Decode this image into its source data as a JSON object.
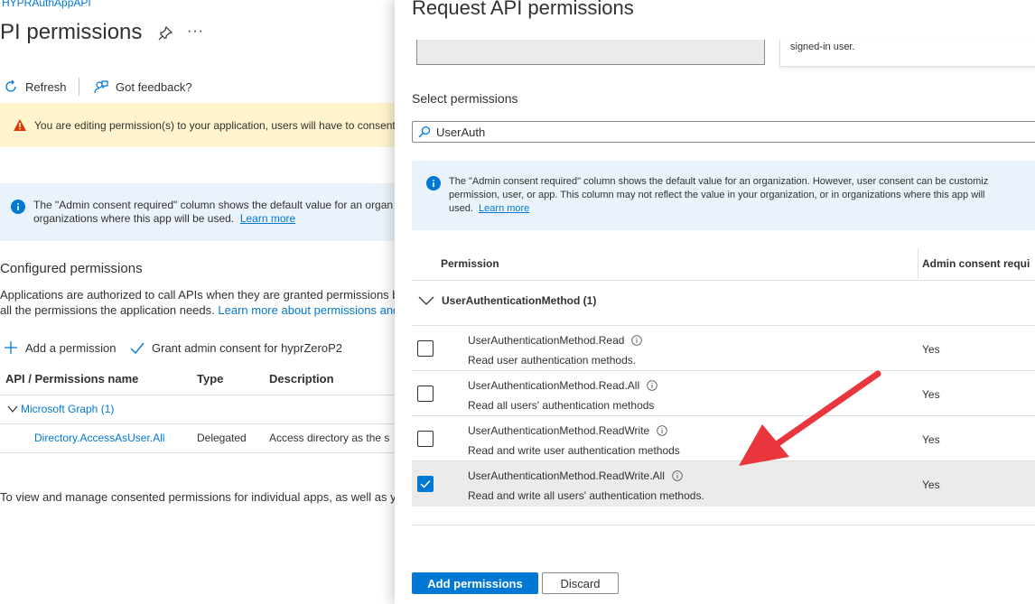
{
  "left": {
    "breadcrumb": "HYPRAuthAppAPI",
    "title": "PI permissions",
    "more": "···",
    "toolbar": {
      "refresh": "Refresh",
      "feedback": "Got feedback?"
    },
    "warning": "You are editing permission(s) to your application, users will have to consent",
    "info": {
      "line1": "The \"Admin consent required\" column shows the default value for an organ",
      "line2": "organizations where this app will be used.",
      "link": "Learn more"
    },
    "configured": {
      "title": "Configured permissions",
      "desc_line1": "Applications are authorized to call APIs when they are granted permissions by",
      "desc_line2": "all the permissions the application needs.",
      "desc_link": "Learn more about permissions and"
    },
    "actions": {
      "add": "Add a permission",
      "grant": "Grant admin consent for hyprZeroP2"
    },
    "table": {
      "headers": {
        "api": "API / Permissions name",
        "type": "Type",
        "description": "Description"
      },
      "group": "Microsoft Graph (1)",
      "rows": [
        {
          "name": "Directory.AccessAsUser.All",
          "type": "Delegated",
          "description": "Access directory as the s"
        }
      ]
    },
    "footer": "To view and manage consented permissions for individual apps, as well as yo"
  },
  "panel": {
    "title": "Request API permissions",
    "top_card_text": "signed-in user.",
    "select_label": "Select permissions",
    "search": {
      "value": "UserAuth"
    },
    "info": {
      "line1": "The \"Admin consent required\" column shows the default value for an organization. However, user consent can be customiz",
      "line2": "permission, user, or app. This column may not reflect the value in your organization, or in organizations where this app will",
      "line3": "used.",
      "link": "Learn more"
    },
    "headers": {
      "permission": "Permission",
      "admin": "Admin consent requi"
    },
    "group": "UserAuthenticationMethod (1)",
    "permissions": [
      {
        "name": "UserAuthenticationMethod.Read",
        "desc": "Read user authentication methods.",
        "admin": "Yes",
        "checked": false
      },
      {
        "name": "UserAuthenticationMethod.Read.All",
        "desc": "Read all users' authentication methods",
        "admin": "Yes",
        "checked": false
      },
      {
        "name": "UserAuthenticationMethod.ReadWrite",
        "desc": "Read and write user authentication methods",
        "admin": "Yes",
        "checked": false
      },
      {
        "name": "UserAuthenticationMethod.ReadWrite.All",
        "desc": "Read and write all users' authentication methods.",
        "admin": "Yes",
        "checked": true
      }
    ],
    "buttons": {
      "add": "Add permissions",
      "discard": "Discard"
    }
  },
  "colors": {
    "accent": "#0078d4",
    "warning_bg": "#fff4ce",
    "info_bg": "#eaf3fb",
    "arrow": "#e8363c"
  }
}
